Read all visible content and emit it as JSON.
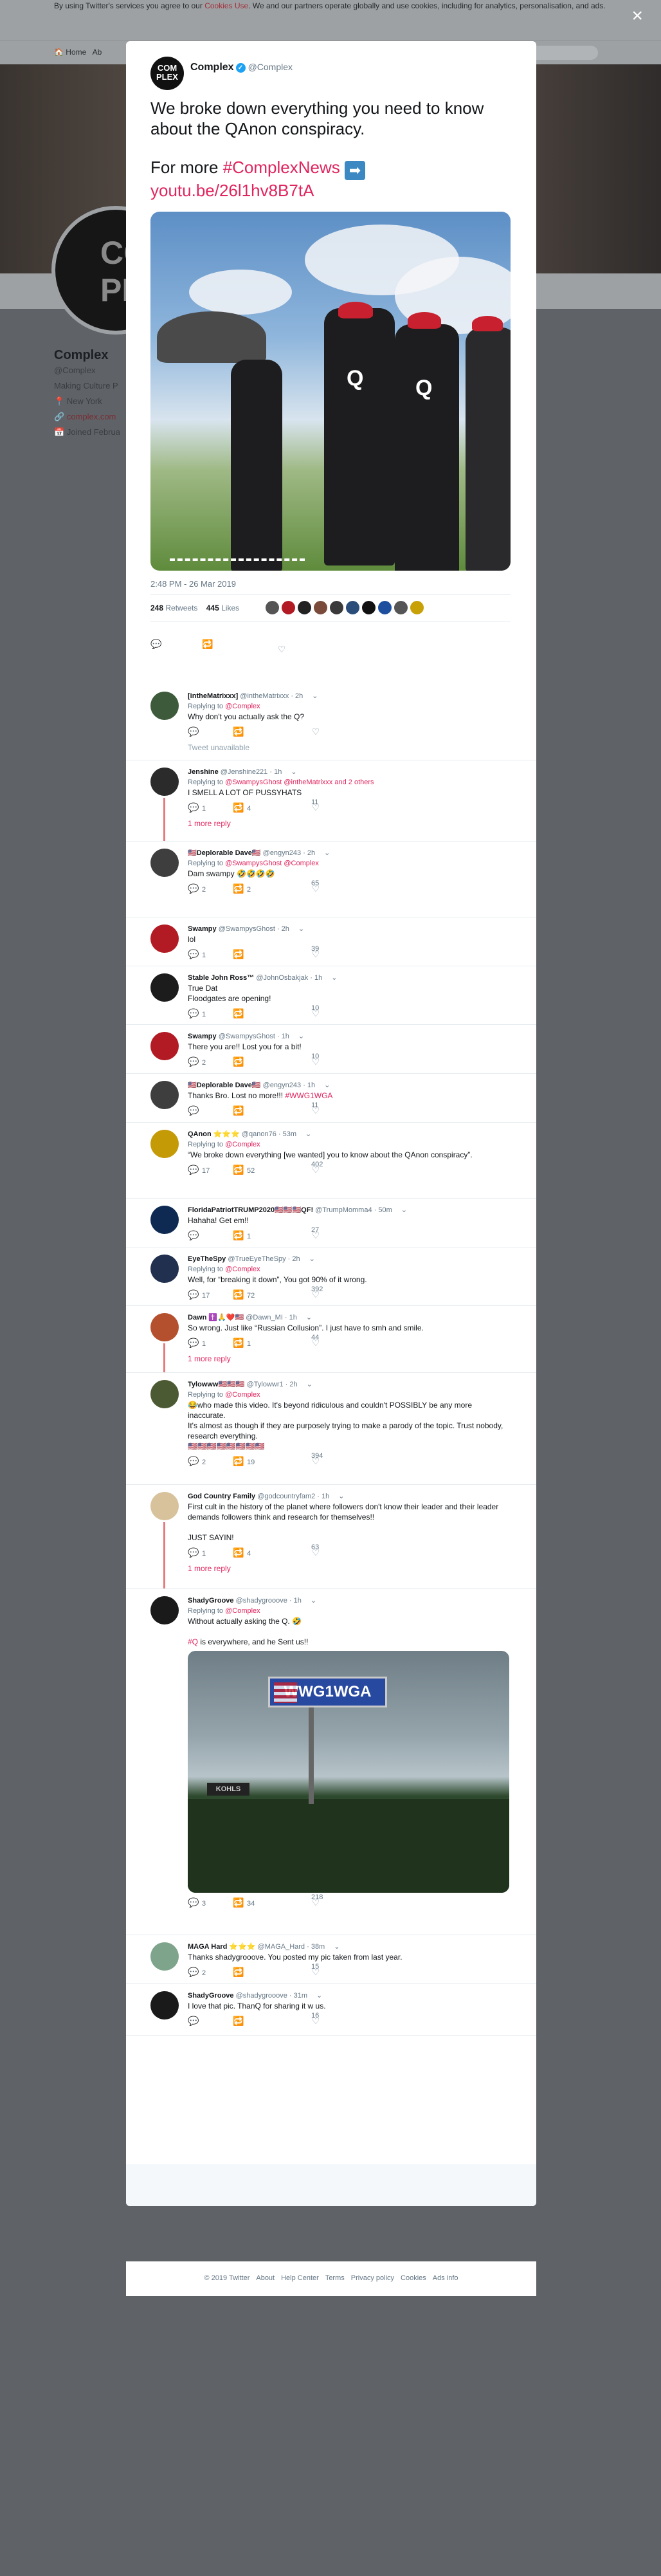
{
  "background": {
    "cookie_prefix": "By using Twitter's services you agree to our ",
    "cookie_link": "Cookies Use",
    "cookie_suffix": ". We and our partners operate globally and use cookies, including for analytics, personalisation, and ads.",
    "nav_home": "Home",
    "nav_about": "Ab",
    "profile_name": "Complex",
    "profile_handle": "@Complex",
    "profile_bio": "Making Culture P",
    "profile_location": "New York",
    "profile_link": "complex.com",
    "profile_joined": "Joined Februa",
    "avatar_text": "COM PLE"
  },
  "close_label": "×",
  "main_tweet": {
    "avatar_text": "COM PLEX",
    "name": "Complex",
    "handle": "@Complex",
    "text_line1": "We broke down everything you need to know about the QAnon conspiracy.",
    "text_for_more": "For more ",
    "hashtag": "#ComplexNews",
    "arrow": "➡",
    "link": "youtu.be/26l1hv8B7tA",
    "time": "2:48 PM - 26 Mar 2019",
    "retweets": "248",
    "retweets_label": "Retweets",
    "likes": "445",
    "likes_label": "Likes"
  },
  "replies": [
    {
      "name": "[intheMatrixxx]",
      "handle": "@intheMatrixxx",
      "time": "2h",
      "replying": "@Complex",
      "text": "Why don't you actually ask the Q?",
      "reply": "",
      "retweet": "",
      "like": "",
      "unavailable": "Tweet unavailable",
      "color": "#3d5a3b"
    },
    {
      "name": "Jenshine",
      "handle": "@Jenshine221",
      "time": "1h",
      "replying": "@SwampysGhost @intheMatrixxx and 2 others",
      "text": "I SMELL A LOT OF PUSSYHATS",
      "reply": "1",
      "retweet": "4",
      "like": "11",
      "more": "1 more reply",
      "color": "#2b2b2b"
    },
    {
      "name": "🇺🇸Deplorable Dave🇺🇸",
      "handle": "@engyn243",
      "time": "2h",
      "replying": "@SwampysGhost @Complex",
      "text": "Dam swampy 🤣🤣🤣🤣",
      "reply": "2",
      "retweet": "2",
      "like": "65",
      "color": "#3e3e3e"
    },
    {
      "name": "Swampy",
      "handle": "@SwampysGhost",
      "time": "2h",
      "replying": "",
      "text": "lol",
      "reply": "1",
      "retweet": "",
      "like": "39",
      "color": "#b31b24"
    },
    {
      "name": "Stable John Ross™",
      "handle": "@JohnOsbakjak",
      "time": "1h",
      "replying": "",
      "text": "True Dat\nFloodgates are opening!",
      "reply": "1",
      "retweet": "",
      "like": "10",
      "color": "#1c1c1c"
    },
    {
      "name": "Swampy",
      "handle": "@SwampysGhost",
      "time": "1h",
      "replying": "",
      "text": "There you are!! Lost you for a bit!",
      "reply": "2",
      "retweet": "",
      "like": "10",
      "color": "#b31b24"
    },
    {
      "name": "🇺🇸Deplorable Dave🇺🇸",
      "handle": "@engyn243",
      "time": "1h",
      "replying": "",
      "text": "Thanks Bro. Lost no more!!! ",
      "tag": "#WWG1WGA",
      "reply": "",
      "retweet": "",
      "like": "11",
      "color": "#3e3e3e"
    },
    {
      "name": "QAnon ⭐⭐⭐",
      "handle": "@qanon76",
      "time": "53m",
      "replying": "@Complex",
      "text": "“We broke down everything [we wanted] you to know about the QAnon conspiracy”.",
      "reply": "17",
      "retweet": "52",
      "like": "402",
      "color": "#c59a07"
    },
    {
      "name": "FloridaPatriotTRUMP2020🇺🇸🇺🇸🇺🇸QF!",
      "handle": "@TrumpMomma4",
      "time": "50m",
      "replying": "",
      "text": "Hahaha! Get em!!",
      "reply": "",
      "retweet": "1",
      "like": "27",
      "color": "#0e2a52"
    },
    {
      "name": "EyeTheSpy",
      "handle": "@TrueEyeTheSpy",
      "time": "2h",
      "replying": "@Complex",
      "text": "Well, for “breaking it down”, You got 90% of it wrong.",
      "reply": "17",
      "retweet": "72",
      "like": "392",
      "color": "#20304e"
    },
    {
      "name": "Dawn ✝️🙏❤️🇺🇸",
      "handle": "@Dawn_MI",
      "time": "1h",
      "replying": "",
      "text": "So wrong.  Just like “Russian Collusion”. I just have to smh and smile.",
      "reply": "1",
      "retweet": "1",
      "like": "44",
      "more": "1 more reply",
      "color": "#b5502f"
    },
    {
      "name": "Tylowww🇺🇸🇺🇸🇺🇸",
      "handle": "@Tylowwr1",
      "time": "2h",
      "replying": "@Complex",
      "text": "😂who made this video. It's beyond ridiculous and couldn't POSSIBLY be any more inaccurate.\nIt's almost as though if they are purposely trying to make a parody of the topic. Trust nobody, research everything.\n🇺🇸🇺🇸🇺🇸🇺🇸🇺🇸🇺🇸🇺🇸🇺🇸",
      "reply": "2",
      "retweet": "19",
      "like": "394",
      "color": "#4c5a33"
    },
    {
      "name": "God Country Family",
      "handle": "@godcountryfam2",
      "time": "1h",
      "replying": "",
      "text": "First cult in the history of the planet where followers don't know their leader and their leader demands followers think and research for themselves!!\n\nJUST SAYIN!",
      "reply": "1",
      "retweet": "4",
      "like": "63",
      "more": "1 more reply",
      "color": "#d8c29b"
    },
    {
      "name": "ShadyGroove",
      "handle": "@shadygrooove",
      "time": "1h",
      "replying": "@Complex",
      "text": "Without actually asking the Q. 🤣\n\n",
      "tag": "#Q",
      "tag_after": " is everywhere, and he Sent us!!",
      "reply": "3",
      "retweet": "34",
      "like": "218",
      "media_text": "WWG1WGA",
      "media_sign2": "KOHLS",
      "color": "#1a1a1a"
    },
    {
      "name": "MAGA Hard ⭐⭐⭐",
      "handle": "@MAGA_Hard",
      "time": "38m",
      "replying": "",
      "text": "Thanks shadygrooove. You posted my pic taken from last year.",
      "reply": "2",
      "retweet": "",
      "like": "15",
      "color": "#7ea48c"
    },
    {
      "name": "ShadyGroove",
      "handle": "@shadygrooove",
      "time": "31m",
      "replying": "",
      "text": "I love that pic. ThanQ for sharing it w us.",
      "reply": "",
      "retweet": "",
      "like": "16",
      "color": "#1a1a1a"
    }
  ],
  "footer": [
    "© 2019 Twitter",
    "About",
    "Help Center",
    "Terms",
    "Privacy policy",
    "Cookies",
    "Ads info"
  ],
  "labels": {
    "replying_to": "Replying to "
  }
}
